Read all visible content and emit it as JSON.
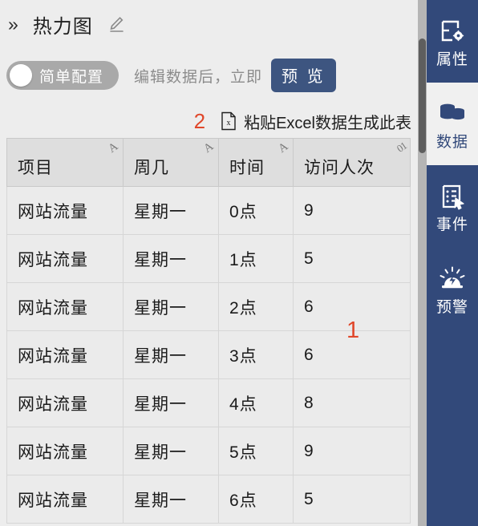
{
  "header": {
    "collapse_icon": "chevrons-right-icon",
    "title": "热力图",
    "collapse_glyph": "»",
    "edit_icon": "pencil-icon"
  },
  "config_bar": {
    "toggle": {
      "label": "简单配置",
      "state": "off",
      "track_color": "#a9a9a9",
      "knob_color": "#ffffff"
    },
    "hint_text": "编辑数据后，立即",
    "preview_label": "预 览",
    "preview_color": "#3d5580"
  },
  "paste_bar": {
    "annotation": "2",
    "annotation_color": "#e0472a",
    "icon": "excel-file-icon",
    "label": "粘贴Excel数据生成此表"
  },
  "table": {
    "columns": [
      {
        "label": "项目",
        "type_icon": "text-type-icon",
        "type_glyph": "A"
      },
      {
        "label": "周几",
        "type_icon": "text-type-icon",
        "type_glyph": "A"
      },
      {
        "label": "时间",
        "type_icon": "text-type-icon",
        "type_glyph": "A"
      },
      {
        "label": "访问人次",
        "type_icon": "number-type-icon",
        "type_glyph": "01"
      }
    ],
    "rows": [
      [
        "网站流量",
        "星期一",
        "0点",
        "9"
      ],
      [
        "网站流量",
        "星期一",
        "1点",
        "5"
      ],
      [
        "网站流量",
        "星期一",
        "2点",
        "6"
      ],
      [
        "网站流量",
        "星期一",
        "3点",
        "6"
      ],
      [
        "网站流量",
        "星期一",
        "4点",
        "8"
      ],
      [
        "网站流量",
        "星期一",
        "5点",
        "9"
      ],
      [
        "网站流量",
        "星期一",
        "6点",
        "5"
      ]
    ],
    "annotation": "1",
    "annotation_color": "#e0472a"
  },
  "scrollbar": {
    "track_color": "#b5b5b5",
    "thumb_color": "#5e5e5e"
  },
  "sidebar": {
    "background": "#32497a",
    "active_background": "#f0f0f0",
    "items": [
      {
        "label": "属性",
        "icon": "properties-icon",
        "active": false
      },
      {
        "label": "数据",
        "icon": "database-icon",
        "active": true
      },
      {
        "label": "事件",
        "icon": "event-list-icon",
        "active": false
      },
      {
        "label": "预警",
        "icon": "alarm-icon",
        "active": false
      }
    ]
  }
}
